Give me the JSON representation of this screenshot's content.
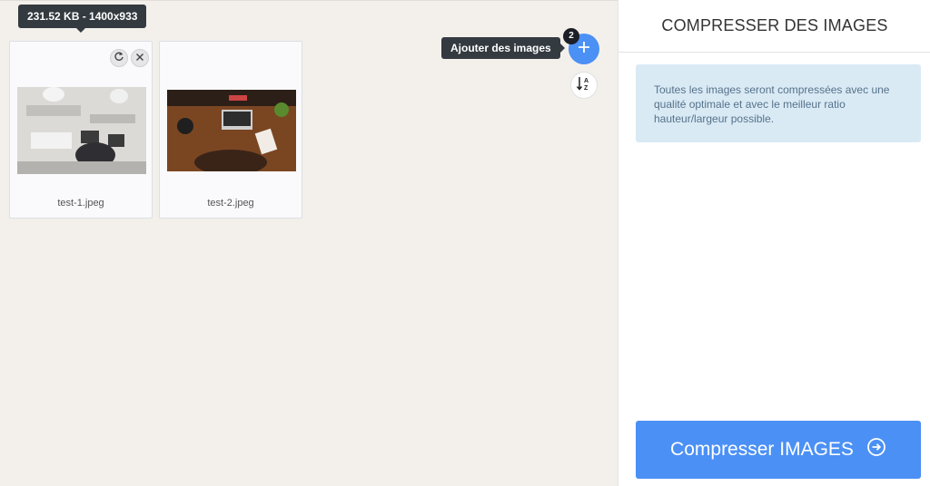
{
  "workspace": {
    "hover_tooltip": "231.52 KB - 1400x933",
    "add_tooltip": "Ajouter des images",
    "file_count": "2",
    "files": [
      {
        "name": "test-1.jpeg"
      },
      {
        "name": "test-2.jpeg"
      }
    ],
    "icons": {
      "add": "plus-icon",
      "sort": "sort-alpha-icon",
      "rotate": "rotate-icon",
      "remove": "close-icon"
    }
  },
  "sidebar": {
    "title": "COMPRESSER DES IMAGES",
    "info_text": "Toutes les images seront compressées avec une qualité optimale et avec le meilleur ratio hauteur/largeur possible.",
    "action_label": "Compresser IMAGES",
    "action_icon": "arrow-circle-right-icon"
  },
  "colors": {
    "accent": "#4b90f5",
    "tooltip_bg": "#333a40",
    "info_bg": "#d9eaf5",
    "workspace_bg": "#f3f0eb"
  }
}
